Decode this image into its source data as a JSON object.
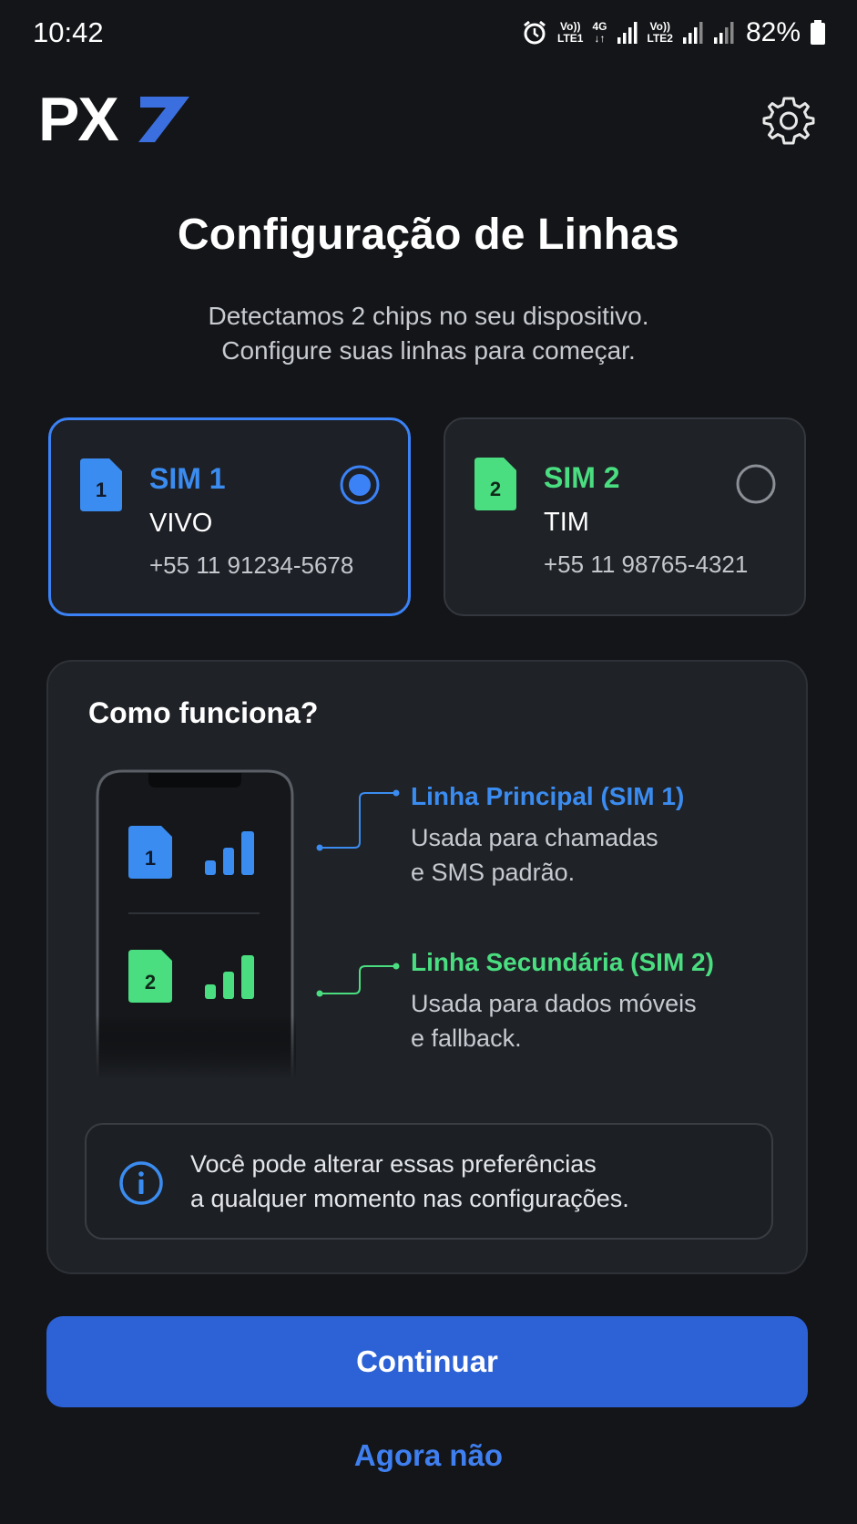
{
  "status_bar": {
    "time": "10:42",
    "net1_top": "Vo))",
    "net1_bottom": "LTE1",
    "net_type": "4G",
    "net2_top": "Vo))",
    "net2_bottom": "LTE2",
    "battery": "82%"
  },
  "brand": {
    "logo_text": "PX7",
    "accent": "#3b6fe0"
  },
  "page": {
    "title": "Configuração de Linhas",
    "subtitle_line1": "Detectamos 2 chips no seu dispositivo.",
    "subtitle_line2": "Configure suas linhas para começar."
  },
  "sims": [
    {
      "chip_label": "1",
      "name": "SIM 1",
      "carrier": "VIVO",
      "number": "+55 11 91234-5678",
      "selected": true,
      "color": "#3b8cf0"
    },
    {
      "chip_label": "2",
      "name": "SIM 2",
      "carrier": "TIM",
      "number": "+55 11 98765-4321",
      "selected": false,
      "color": "#4ade80"
    }
  ],
  "how": {
    "title": "Como funciona?",
    "primary": {
      "title": "Linha Principal (SIM 1)",
      "desc1": "Usada para chamadas",
      "desc2": "e SMS padrão."
    },
    "secondary": {
      "title": "Linha Secundária (SIM 2)",
      "desc1": "Usada para dados móveis",
      "desc2": "e fallback."
    },
    "info_line1": "Você pode alterar essas preferências",
    "info_line2": "a qualquer momento nas configurações."
  },
  "actions": {
    "continue": "Continuar",
    "later": "Agora não"
  },
  "colors": {
    "blue": "#3b8cf0",
    "green": "#4ade80",
    "button": "#2c62d6",
    "background": "#131518"
  }
}
